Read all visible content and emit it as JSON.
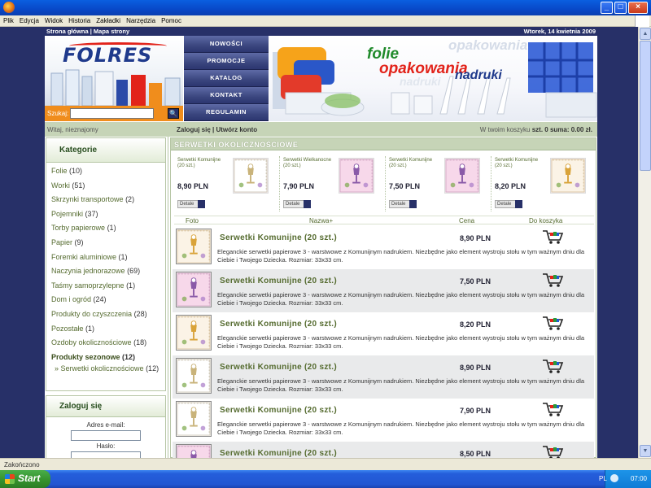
{
  "browser": {
    "menu": [
      "Plik",
      "Edycja",
      "Widok",
      "Historia",
      "Zakładki",
      "Narzędzia",
      "Pomoc"
    ],
    "window_buttons": [
      "_",
      "□",
      "×"
    ],
    "status_text": "Zakończono"
  },
  "site": {
    "top_links": "Strona główna | Mapa strony",
    "date": "Wtorek, 14 kwietnia 2009",
    "logo_text": "FOLRES",
    "search_label": "Szukaj:",
    "search_button": "🔍",
    "nav": [
      "NOWOŚCI",
      "PROMOCJE",
      "KATALOG",
      "KONTAKT",
      "REGULAMIN"
    ],
    "banner": {
      "line1": "folie",
      "line2": "opakowania",
      "line3": "nadruki"
    },
    "userbar": {
      "welcome": "Witaj, nieznajomy",
      "login_links": "Zaloguj się | Utwórz konto",
      "cart_prefix": "W twoim koszyku",
      "cart_value": "szt. 0 suma: 0.00 zł."
    },
    "categories_title": "Kategorie",
    "categories": [
      {
        "name": "Folie",
        "count": "(10)",
        "bold": false
      },
      {
        "name": "Worki",
        "count": "(51)",
        "bold": false
      },
      {
        "name": "Skrzynki transportowe",
        "count": "(2)",
        "bold": false
      },
      {
        "name": "Pojemniki",
        "count": "(37)",
        "bold": false
      },
      {
        "name": "Torby papierowe",
        "count": "(1)",
        "bold": false
      },
      {
        "name": "Papier",
        "count": "(9)",
        "bold": false
      },
      {
        "name": "Foremki aluminiowe",
        "count": "(1)",
        "bold": false
      },
      {
        "name": "Naczynia jednorazowe",
        "count": "(69)",
        "bold": false
      },
      {
        "name": "Taśmy samoprzylepne",
        "count": "(1)",
        "bold": false
      },
      {
        "name": "Dom i ogród",
        "count": "(24)",
        "bold": false
      },
      {
        "name": "Produkty do czyszczenia",
        "count": "(28)",
        "bold": false
      },
      {
        "name": "Pozostałe",
        "count": "(1)",
        "bold": false
      },
      {
        "name": "Ozdoby okolicznościowe",
        "count": "(18)",
        "bold": false
      },
      {
        "name": "Produkty sezonowe",
        "count": "(12)",
        "bold": true
      }
    ],
    "subcategory": {
      "name": "» Serwetki okolicznościowe",
      "count": "(12)"
    },
    "login_box": {
      "title": "Zaloguj się",
      "email_label": "Adres e-mail:",
      "password_label": "Hasło:"
    },
    "section_title": "SERWETKI OKOLICZNOŚCIOWE",
    "featured": [
      {
        "name": "Serwetki Komunijne (20 szt.)",
        "price": "8,90 PLN",
        "details": "Detale"
      },
      {
        "name": "Serwetki Wielkanocne (20 szt.)",
        "price": "7,90 PLN",
        "details": "Detale"
      },
      {
        "name": "Serwetki Komunijne (20 szt.)",
        "price": "7,50 PLN",
        "details": "Detale"
      },
      {
        "name": "Serwetki Komunijne (20 szt.)",
        "price": "8,20 PLN",
        "details": "Detale"
      }
    ],
    "list_headers": {
      "photo": "Foto",
      "name": "Nazwa+",
      "price": "Cena",
      "cart": "Do koszyka"
    },
    "products": [
      {
        "name": "Serwetki Komunijne (20 szt.)",
        "price": "8,90 PLN",
        "desc": "Eleganckie serwetki papierowe 3 - warstwowe z Komunijnym nadrukiem. Niezbędne jako element wystroju stołu w tym ważnym dniu dla Ciebie i Twojego Dziecka. Rozmiar: 33x33 cm."
      },
      {
        "name": "Serwetki Komunijne (20 szt.)",
        "price": "7,50 PLN",
        "desc": "Eleganckie serwetki papierowe 3 - warstwowe z Komunijnym nadrukiem. Niezbędne jako element wystroju stołu w tym ważnym dniu dla Ciebie i Twojego Dziecka. Rozmiar: 33x33 cm."
      },
      {
        "name": "Serwetki Komunijne (20 szt.)",
        "price": "8,20 PLN",
        "desc": "Eleganckie serwetki papierowe 3 - warstwowe z Komunijnym nadrukiem. Niezbędne jako element wystroju stołu w tym ważnym dniu dla Ciebie i Twojego Dziecka. Rozmiar: 33x33 cm."
      },
      {
        "name": "Serwetki Komunijne (20 szt.)",
        "price": "8,90 PLN",
        "desc": "Eleganckie serwetki papierowe 3 - warstwowe z Komunijnym nadrukiem. Niezbędne jako element wystroju stołu w tym ważnym dniu dla Ciebie i Twojego Dziecka. Rozmiar: 33x33 cm."
      },
      {
        "name": "Serwetki Komunijne (20 szt.)",
        "price": "7,90 PLN",
        "desc": "Eleganckie serwetki papierowe 3 - warstwowe z Komunijnym nadrukiem. Niezbędne jako element wystroju stołu w tym ważnym dniu dla Ciebie i Twojego Dziecka. Rozmiar: 33x33 cm."
      },
      {
        "name": "Serwetki Komunijne (20 szt.)",
        "price": "8,50 PLN",
        "desc": ""
      }
    ]
  },
  "taskbar": {
    "start_label": "Start",
    "language": "PL",
    "clock": "07:00"
  },
  "colors": {
    "page_bg": "#273068",
    "accent_green": "#556b2f",
    "search_orange": "#f08d1c",
    "nav_blue": "#3b467f"
  }
}
